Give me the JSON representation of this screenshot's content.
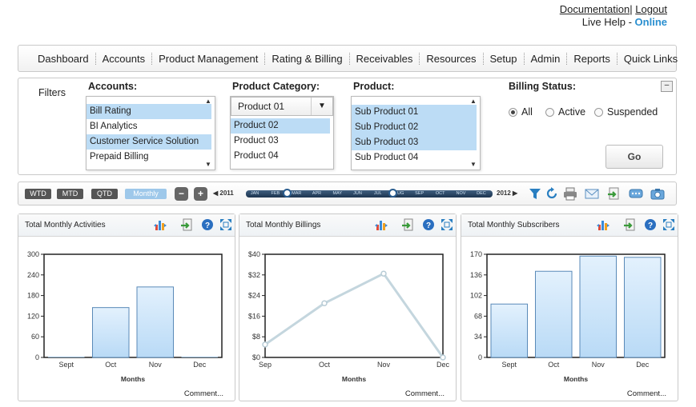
{
  "top_links": {
    "documentation": "Documentation",
    "logout": "Logout",
    "separator": "|",
    "live_help": "Live Help - ",
    "status": "Online"
  },
  "nav": [
    "Dashboard",
    "Accounts",
    "Product Management",
    "Rating & Billing",
    "Receivables",
    "Resources",
    "Setup",
    "Admin",
    "Reports",
    "Quick Links"
  ],
  "filters": {
    "label": "Filters",
    "accounts": {
      "label": "Accounts:",
      "options": [
        {
          "text": "Bill Rating",
          "selected": true
        },
        {
          "text": "BI Analytics",
          "selected": false
        },
        {
          "text": "Customer Service Solution",
          "selected": true
        },
        {
          "text": "Prepaid Billing",
          "selected": false
        }
      ]
    },
    "product_category": {
      "label": "Product Category:",
      "selected": "Product 01",
      "options": [
        {
          "text": "Product 02",
          "selected": true
        },
        {
          "text": "Product 03",
          "selected": false
        },
        {
          "text": "Product 04",
          "selected": false
        }
      ]
    },
    "product": {
      "label": "Product:",
      "options": [
        {
          "text": "Sub Product 01",
          "selected": true
        },
        {
          "text": "Sub Product 02",
          "selected": true
        },
        {
          "text": "Sub Product 03",
          "selected": true
        },
        {
          "text": "Sub Product 04",
          "selected": false
        }
      ]
    },
    "billing_status": {
      "label": "Billing Status:",
      "options": [
        {
          "text": "All",
          "selected": true
        },
        {
          "text": "Active",
          "selected": false
        },
        {
          "text": "Suspended",
          "selected": false
        }
      ]
    },
    "go": "Go"
  },
  "periods": [
    {
      "text": "WTD",
      "active": false
    },
    {
      "text": "MTD",
      "active": false
    },
    {
      "text": "QTD",
      "active": false
    },
    {
      "text": "Monthly",
      "active": true
    }
  ],
  "timeline": {
    "start_year": "2011",
    "end_year": "2012",
    "months": [
      "JAN",
      "FEB",
      "MAR",
      "APR",
      "MAY",
      "JUN",
      "JUL",
      "AUG",
      "SEP",
      "OCT",
      "NOV",
      "DEC"
    ]
  },
  "panels": [
    {
      "title": "Total Monthly Activities",
      "comment": "Comment..."
    },
    {
      "title": "Total Monthly Billings",
      "comment": "Comment..."
    },
    {
      "title": "Total Monthly Subscribers",
      "comment": "Comment..."
    }
  ],
  "chart_data": [
    {
      "type": "bar",
      "title": "Total Monthly Activities",
      "xlabel": "Months",
      "ylabel": "",
      "categories": [
        "Sept",
        "Oct",
        "Nov",
        "Dec"
      ],
      "values": [
        0,
        145,
        205,
        0
      ],
      "ylim": [
        0,
        300
      ],
      "yticks": [
        "0",
        "60",
        "120",
        "180",
        "240",
        "300"
      ],
      "grid": false,
      "color": "#cfe6fb"
    },
    {
      "type": "line",
      "title": "Total Monthly Billings",
      "xlabel": "Months",
      "ylabel": "",
      "categories": [
        "Sep",
        "Oct",
        "Nov",
        "Dec"
      ],
      "points": [
        {
          "x": 0,
          "y": 5
        },
        {
          "x": 1,
          "y": 21
        },
        {
          "x": 2,
          "y": 32.5
        },
        {
          "x": 3,
          "y": 0
        }
      ],
      "ylim": [
        0,
        40
      ],
      "yticks": [
        "$0",
        "$8",
        "$16",
        "$24",
        "$32",
        "$40"
      ],
      "grid": false,
      "color": "#c4d6de"
    },
    {
      "type": "bar",
      "title": "Total Monthly Subscribers",
      "xlabel": "Months",
      "ylabel": "",
      "categories": [
        "Sept",
        "Oct",
        "Nov",
        "Dec"
      ],
      "values": [
        88,
        142,
        167,
        165
      ],
      "ylim": [
        0,
        170
      ],
      "yticks": [
        "0",
        "34",
        "68",
        "102",
        "136",
        "170"
      ],
      "grid": false,
      "color": "#cfe6fb"
    }
  ]
}
